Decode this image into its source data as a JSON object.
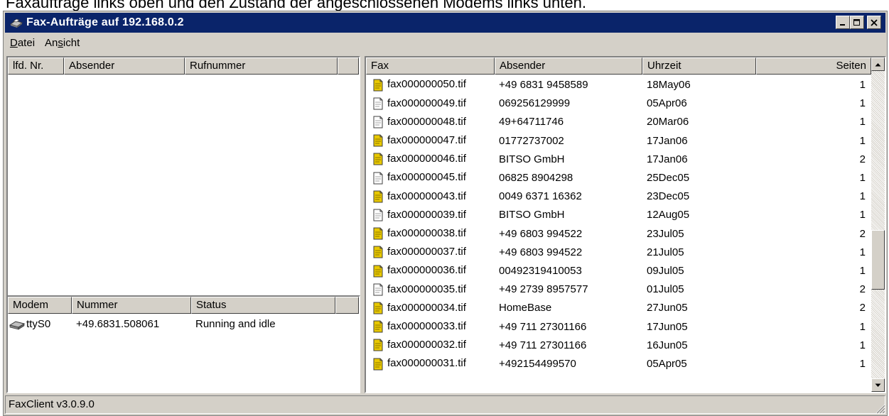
{
  "caption": "Faxaufträge links oben und den Zustand der angeschlossenen Modems links unten.",
  "window": {
    "title": "Fax-Aufträge auf 192.168.0.2",
    "menu": [
      {
        "pre": "",
        "u": "D",
        "post": "atei"
      },
      {
        "pre": "An",
        "u": "s",
        "post": "icht"
      }
    ]
  },
  "jobs": {
    "columns": [
      "lfd. Nr.",
      "Absender",
      "Rufnummer"
    ],
    "rows": []
  },
  "modems": {
    "columns": [
      "Modem",
      "Nummer",
      "Status"
    ],
    "rows": [
      {
        "modem": "ttyS0",
        "nummer": "+49.6831.508061",
        "status": "Running and idle"
      }
    ]
  },
  "faxes": {
    "columns": [
      "Fax",
      "Absender",
      "Uhrzeit",
      "Seiten"
    ],
    "rows": [
      {
        "fax": "fax000000050.tif",
        "absender": "+49 6831 9458589",
        "uhrzeit": "18May06",
        "seiten": "1",
        "icon": "yellow"
      },
      {
        "fax": "fax000000049.tif",
        "absender": "069256129999",
        "uhrzeit": "05Apr06",
        "seiten": "1",
        "icon": "white"
      },
      {
        "fax": "fax000000048.tif",
        "absender": "49+64711746",
        "uhrzeit": "20Mar06",
        "seiten": "1",
        "icon": "white"
      },
      {
        "fax": "fax000000047.tif",
        "absender": "01772737002",
        "uhrzeit": "17Jan06",
        "seiten": "1",
        "icon": "yellow"
      },
      {
        "fax": "fax000000046.tif",
        "absender": "BITSO GmbH",
        "uhrzeit": "17Jan06",
        "seiten": "2",
        "icon": "yellow"
      },
      {
        "fax": "fax000000045.tif",
        "absender": "06825 8904298",
        "uhrzeit": "25Dec05",
        "seiten": "1",
        "icon": "white"
      },
      {
        "fax": "fax000000043.tif",
        "absender": "0049 6371 16362",
        "uhrzeit": "23Dec05",
        "seiten": "1",
        "icon": "yellow"
      },
      {
        "fax": "fax000000039.tif",
        "absender": "BITSO GmbH",
        "uhrzeit": "12Aug05",
        "seiten": "1",
        "icon": "white"
      },
      {
        "fax": "fax000000038.tif",
        "absender": "+49 6803 994522",
        "uhrzeit": "23Jul05",
        "seiten": "2",
        "icon": "yellow"
      },
      {
        "fax": "fax000000037.tif",
        "absender": "+49 6803 994522",
        "uhrzeit": "21Jul05",
        "seiten": "1",
        "icon": "yellow"
      },
      {
        "fax": "fax000000036.tif",
        "absender": "00492319410053",
        "uhrzeit": "09Jul05",
        "seiten": "1",
        "icon": "yellow"
      },
      {
        "fax": "fax000000035.tif",
        "absender": "+49 2739 8957577",
        "uhrzeit": "01Jul05",
        "seiten": "2",
        "icon": "white"
      },
      {
        "fax": "fax000000034.tif",
        "absender": "HomeBase",
        "uhrzeit": "27Jun05",
        "seiten": "2",
        "icon": "yellow"
      },
      {
        "fax": "fax000000033.tif",
        "absender": "+49 711 27301166",
        "uhrzeit": "17Jun05",
        "seiten": "1",
        "icon": "yellow"
      },
      {
        "fax": "fax000000032.tif",
        "absender": "+49 711 27301166",
        "uhrzeit": "16Jun05",
        "seiten": "1",
        "icon": "yellow"
      },
      {
        "fax": "fax000000031.tif",
        "absender": "+492154499570",
        "uhrzeit": "05Apr05",
        "seiten": "1",
        "icon": "yellow"
      }
    ]
  },
  "status_bar": "FaxClient v3.0.9.0",
  "colors": {
    "titlebar": "#0a246a",
    "face": "#d4d0c8",
    "fax_icon_yellow": "#e8c800",
    "fax_icon_white": "#ffffff"
  }
}
